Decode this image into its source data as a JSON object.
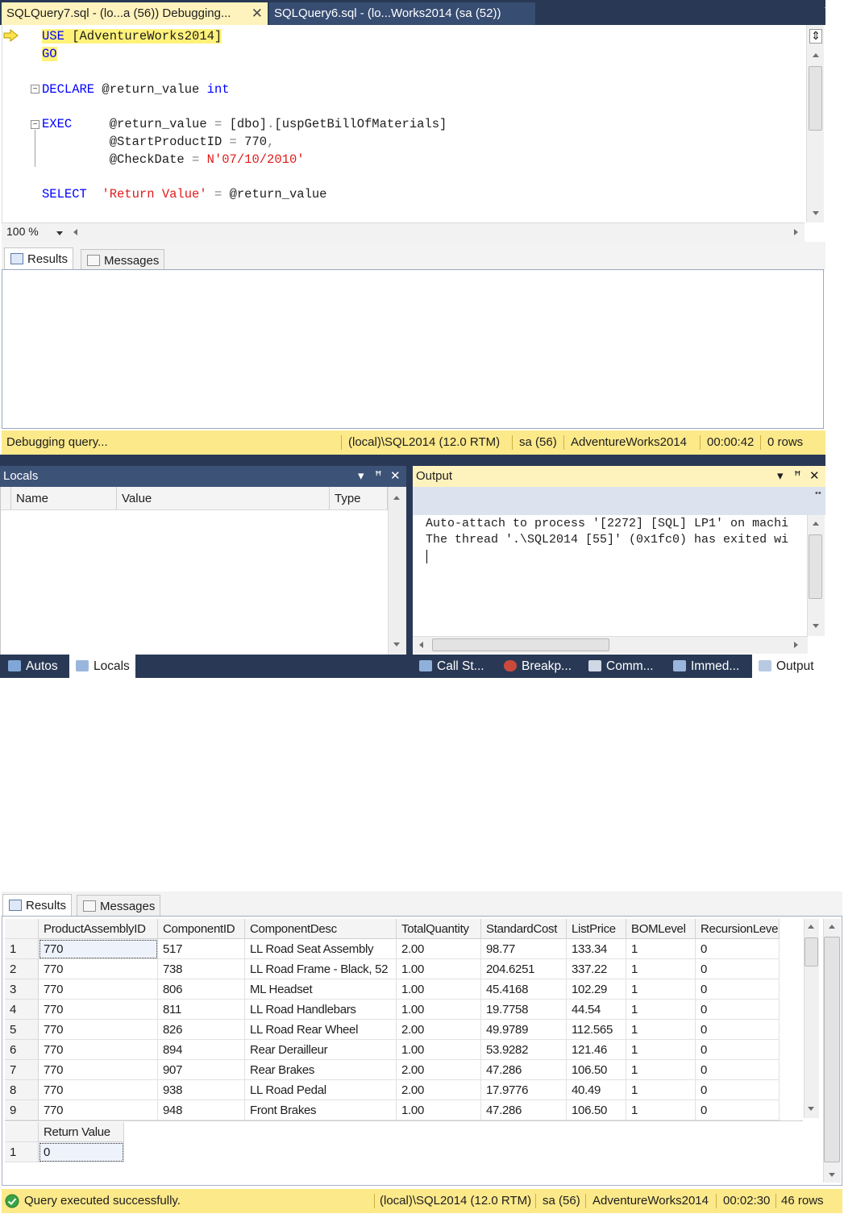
{
  "editor_tabs": [
    {
      "label": "SQLQuery7.sql - (lo...a (56)) Debugging...",
      "active": true
    },
    {
      "label": "SQLQuery6.sql - (lo...Works2014 (sa (52))",
      "active": false
    }
  ],
  "code": {
    "line1": {
      "kw": "USE",
      "rest": " [AdventureWorks2014]"
    },
    "line2": {
      "kw": "GO"
    },
    "line3": {
      "kw": "DECLARE",
      "mid": " @return_value ",
      "type": "int"
    },
    "line4": {
      "kw": "EXEC",
      "pad": "     ",
      "var": "@return_value",
      "eq": " = ",
      "obj1": "[dbo]",
      "dot": ".",
      "obj2": "[uspGetBillOfMaterials]"
    },
    "line5": {
      "pad": "         ",
      "var": "@StartProductID",
      "eq": " = ",
      "val": "770",
      "comma": ","
    },
    "line6": {
      "pad": "         ",
      "var": "@CheckDate",
      "eq": " = ",
      "str": "N'07/10/2010'"
    },
    "line7": {
      "kw": "SELECT",
      "pad": "  ",
      "str": "'Return Value'",
      "eq": " = ",
      "var": "@return_value"
    }
  },
  "zoom": "100 %",
  "results_tabs": {
    "results": "Results",
    "messages": "Messages"
  },
  "status_debug": {
    "message": "Debugging query...",
    "server": "(local)\\SQL2014 (12.0 RTM)",
    "user": "sa (56)",
    "database": "AdventureWorks2014",
    "elapsed": "00:00:42",
    "rows": "0 rows"
  },
  "locals": {
    "title": "Locals",
    "columns": {
      "name": "Name",
      "value": "Value",
      "type": "Type"
    }
  },
  "output": {
    "title": "Output",
    "lines": [
      "Auto-attach to process '[2272] [SQL] LP1' on machi",
      "The thread '.\\SQL2014 [55]' (0x1fc0) has exited wi"
    ]
  },
  "tool_tabs": {
    "autos": "Autos",
    "locals": "Locals",
    "callstack": "Call St...",
    "breakpoints": "Breakp...",
    "command": "Comm...",
    "immediate": "Immed...",
    "output": "Output"
  },
  "grid": {
    "columns": [
      "ProductAssemblyID",
      "ComponentID",
      "ComponentDesc",
      "TotalQuantity",
      "StandardCost",
      "ListPrice",
      "BOMLevel",
      "RecursionLevel"
    ],
    "rows": [
      [
        "1",
        "770",
        "517",
        "LL Road Seat Assembly",
        "2.00",
        "98.77",
        "133.34",
        "1",
        "0"
      ],
      [
        "2",
        "770",
        "738",
        "LL Road Frame - Black, 52",
        "1.00",
        "204.6251",
        "337.22",
        "1",
        "0"
      ],
      [
        "3",
        "770",
        "806",
        "ML Headset",
        "1.00",
        "45.4168",
        "102.29",
        "1",
        "0"
      ],
      [
        "4",
        "770",
        "811",
        "LL Road Handlebars",
        "1.00",
        "19.7758",
        "44.54",
        "1",
        "0"
      ],
      [
        "5",
        "770",
        "826",
        "LL Road Rear Wheel",
        "2.00",
        "49.9789",
        "112.565",
        "1",
        "0"
      ],
      [
        "6",
        "770",
        "894",
        "Rear Derailleur",
        "1.00",
        "53.9282",
        "121.46",
        "1",
        "0"
      ],
      [
        "7",
        "770",
        "907",
        "Rear Brakes",
        "2.00",
        "47.286",
        "106.50",
        "1",
        "0"
      ],
      [
        "8",
        "770",
        "938",
        "LL Road Pedal",
        "2.00",
        "17.9776",
        "40.49",
        "1",
        "0"
      ],
      [
        "9",
        "770",
        "948",
        "Front Brakes",
        "1.00",
        "47.286",
        "106.50",
        "1",
        "0"
      ]
    ],
    "return_value_header": "Return Value",
    "return_value_row": [
      "1",
      "0"
    ]
  },
  "status_done": {
    "message": "Query executed successfully.",
    "server": "(local)\\SQL2014 (12.0 RTM)",
    "user": "sa (56)",
    "database": "AdventureWorks2014",
    "elapsed": "00:02:30",
    "rows": "46 rows"
  },
  "colors": {
    "chrome_dark": "#293955",
    "active_tab": "#fff3bd",
    "status_yellow": "#fce98a",
    "keyword_blue": "#0000ff",
    "string_red": "#e01b1b"
  }
}
